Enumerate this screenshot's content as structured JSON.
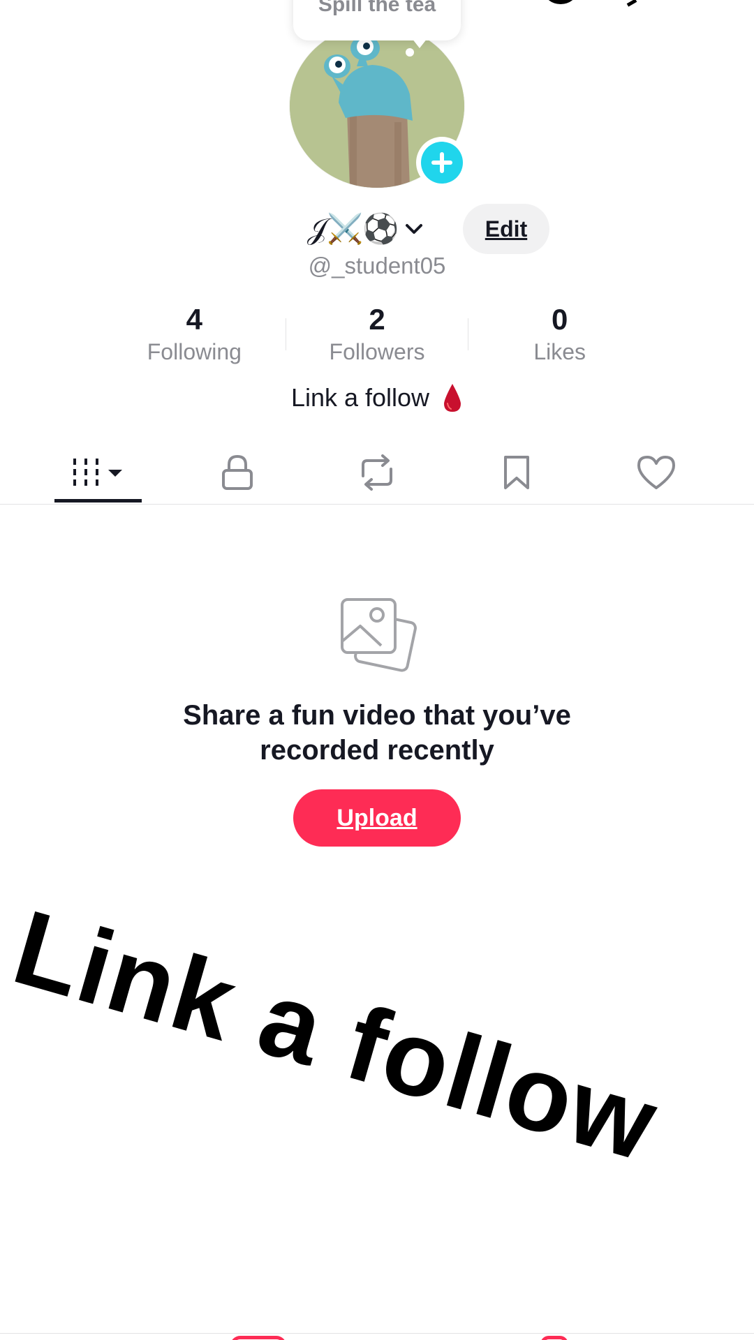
{
  "tooltip": {
    "text": "Spill the tea"
  },
  "profile": {
    "display_name": "𝒥⚔️⚽",
    "username": "@_student05",
    "edit_label": "Edit",
    "bio": "Link a follow"
  },
  "stats": [
    {
      "value": "4",
      "label": "Following"
    },
    {
      "value": "2",
      "label": "Followers"
    },
    {
      "value": "0",
      "label": "Likes"
    }
  ],
  "tabs": [
    {
      "name": "videos",
      "icon": "grid-dropdown-icon",
      "active": true
    },
    {
      "name": "private",
      "icon": "lock-icon",
      "active": false
    },
    {
      "name": "reposts",
      "icon": "repost-icon",
      "active": false
    },
    {
      "name": "favorites",
      "icon": "bookmark-icon",
      "active": false
    },
    {
      "name": "liked",
      "icon": "heart-icon",
      "active": false
    }
  ],
  "empty_state": {
    "icon": "photos-icon",
    "title_line1": "Share a fun video that you’ve",
    "title_line2": "recorded recently",
    "upload_label": "Upload"
  },
  "overlay": {
    "text": "Link a follow"
  },
  "colors": {
    "accent": "#fe2c55",
    "add_button": "#20d5ec",
    "secondary_text": "#8a8b91",
    "primary_text": "#161823"
  }
}
